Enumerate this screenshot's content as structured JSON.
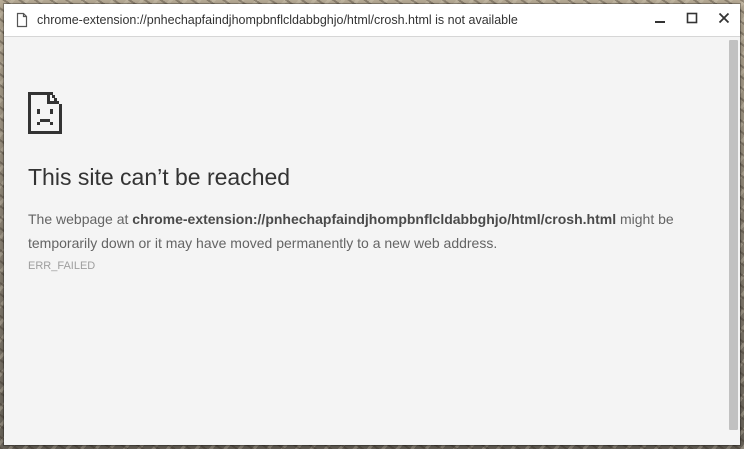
{
  "window": {
    "title": "chrome-extension://pnhechapfaindjhompbnflcldabbghjo/html/crosh.html is not available",
    "controls": [
      "minimize",
      "maximize",
      "close"
    ]
  },
  "error": {
    "icon": "sad-page-icon",
    "heading": "This site can’t be reached",
    "body_prefix": "The webpage at ",
    "body_url": "chrome-extension://pnhechapfaindjhompbnflcldabbghjo/html/crosh.html",
    "body_suffix": " might be temporarily down or it may have moved permanently to a new web address.",
    "code": "ERR_FAILED"
  },
  "colors": {
    "page_background": "#f4f4f4",
    "heading": "#333333",
    "body_text": "#646464",
    "error_code": "#9e9e9e",
    "scrollbar_thumb": "#c1c1c1"
  }
}
